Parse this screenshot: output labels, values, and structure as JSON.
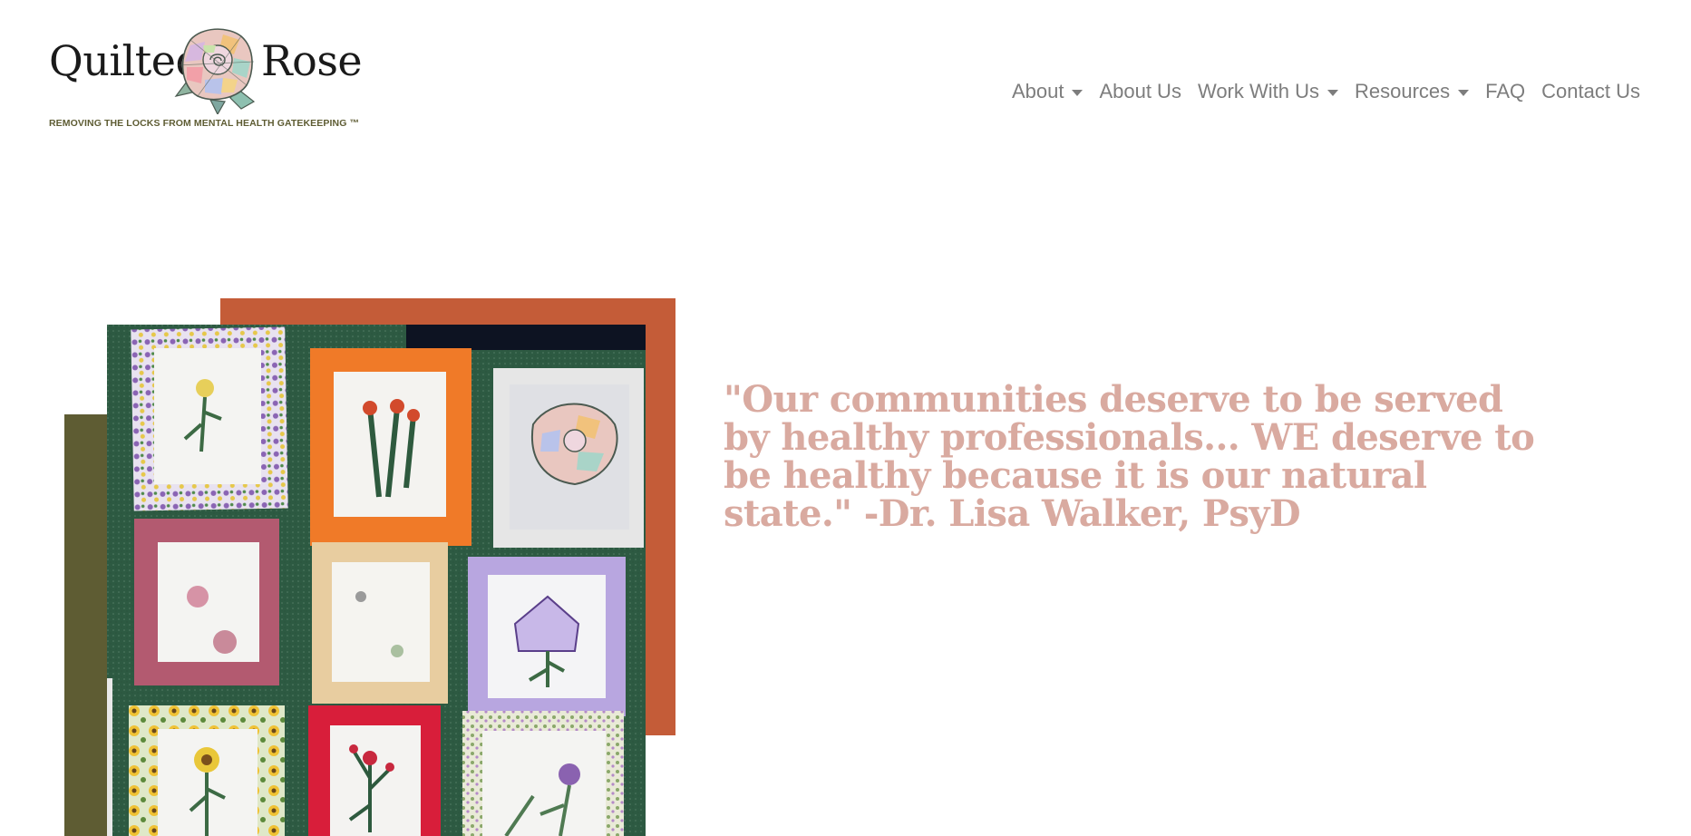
{
  "brand": {
    "name_part1": "Quilted",
    "name_part2": "Rose",
    "logo_icon": "quilted-rose-icon",
    "tagline": "REMOVING THE LOCKS FROM MENTAL HEALTH GATEKEEPING ™"
  },
  "nav": {
    "items": [
      {
        "label": "About",
        "has_dropdown": true
      },
      {
        "label": "About Us",
        "has_dropdown": false
      },
      {
        "label": "Work With Us",
        "has_dropdown": true
      },
      {
        "label": "Resources",
        "has_dropdown": true
      },
      {
        "label": "FAQ",
        "has_dropdown": false
      },
      {
        "label": "Contact Us",
        "has_dropdown": false
      }
    ],
    "dropdown_icon": "caret-down-icon"
  },
  "hero": {
    "image": "quilt-photo",
    "quote": "\"Our communities deserve to be served by healthy professionals... WE deserve to be healthy because it is our natural state.\" -Dr. Lisa Walker, PsyD"
  },
  "colors": {
    "olive": "#5e5c33",
    "rust": "#c45c38",
    "quote": "#d9aaa0",
    "nav_text": "#7d7d7d"
  }
}
